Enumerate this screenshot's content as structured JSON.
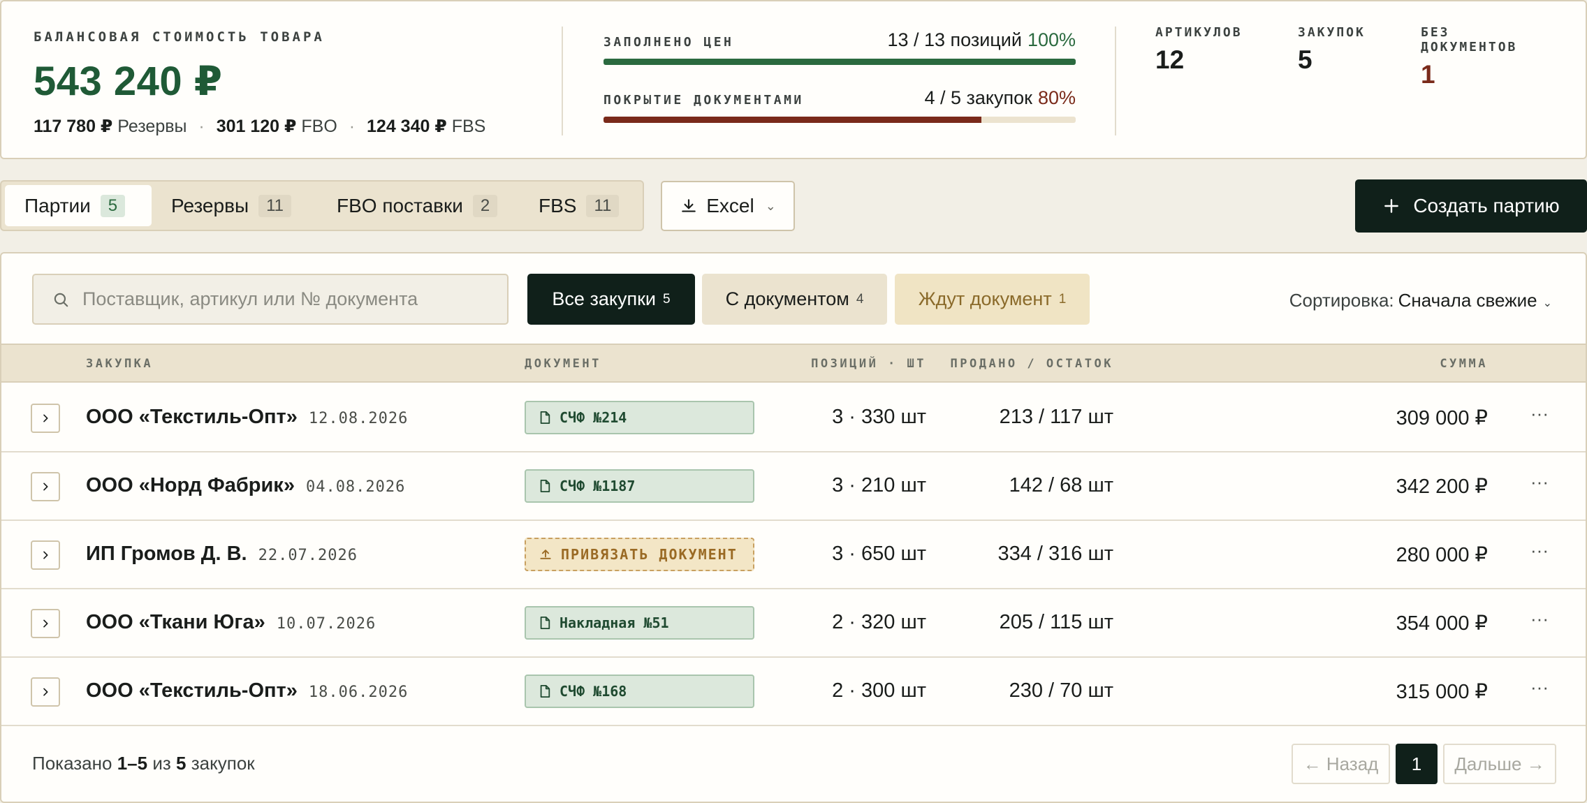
{
  "summary": {
    "balance_label": "Балансовая стоимость товара",
    "balance_value": "543 240 ₽",
    "breakdown": [
      {
        "value": "117 780 ₽",
        "label": "Резервы"
      },
      {
        "value": "301 120 ₽",
        "label": "FBO"
      },
      {
        "value": "124 340 ₽",
        "label": "FBS"
      }
    ],
    "breakdown_sep": "·",
    "prices": {
      "label": "Заполнено цен",
      "count": "13 / 13 позиций",
      "percent": "100%",
      "fill": 1.0
    },
    "docs": {
      "label": "Покрытие документами",
      "count": "4 / 5 закупок",
      "percent": "80%",
      "fill": 0.8
    },
    "stats": [
      {
        "label": "Артикулов",
        "value": "12"
      },
      {
        "label": "Закупок",
        "value": "5"
      },
      {
        "label": "Без документов",
        "value": "1"
      }
    ]
  },
  "tabs": [
    {
      "label": "Партии",
      "count": "5"
    },
    {
      "label": "Резервы",
      "count": "11"
    },
    {
      "label": "FBO поставки",
      "count": "2"
    },
    {
      "label": "FBS",
      "count": "11"
    }
  ],
  "toolbar": {
    "excel_label": "Excel",
    "create_label": "Создать партию"
  },
  "search": {
    "placeholder": "Поставщик, артикул или № документа"
  },
  "filters": [
    {
      "label": "Все закупки",
      "count": "5"
    },
    {
      "label": "С документом",
      "count": "4"
    },
    {
      "label": "Ждут документ",
      "count": "1"
    }
  ],
  "sort": {
    "label": "Сортировка:",
    "value": "Сначала свежие"
  },
  "table": {
    "headers": {
      "purchase": "Закупка",
      "document": "Документ",
      "positions": "Позиций · шт",
      "sold": "Продано / остаток",
      "sum": "Сумма"
    },
    "rows": [
      {
        "supplier": "ООО «Текстиль-Опт»",
        "date": "12.08.2026",
        "doc": "СЧФ №214",
        "doc_status": "ok",
        "positions": "3 · 330 шт",
        "sold": "213 / 117 шт",
        "sum": "309 000 ₽"
      },
      {
        "supplier": "ООО «Норд Фабрик»",
        "date": "04.08.2026",
        "doc": "СЧФ №1187",
        "doc_status": "ok",
        "positions": "3 · 210 шт",
        "sold": "142 / 68 шт",
        "sum": "342 200 ₽"
      },
      {
        "supplier": "ИП Громов Д. В.",
        "date": "22.07.2026",
        "doc": "ПРИВЯЗАТЬ ДОКУМЕНТ",
        "doc_status": "pending",
        "positions": "3 · 650 шт",
        "sold": "334 / 316 шт",
        "sum": "280 000 ₽"
      },
      {
        "supplier": "ООО «Ткани Юга»",
        "date": "10.07.2026",
        "doc": "Накладная №51",
        "doc_status": "ok",
        "positions": "2 · 320 шт",
        "sold": "205 / 115 шт",
        "sum": "354 000 ₽"
      },
      {
        "supplier": "ООО «Текстиль-Опт»",
        "date": "18.06.2026",
        "doc": "СЧФ №168",
        "doc_status": "ok",
        "positions": "2 · 300 шт",
        "sold": "230 / 70 шт",
        "sum": "315 000 ₽"
      }
    ],
    "more_glyph": "···"
  },
  "footer": {
    "prefix": "Показано",
    "range": "1–5",
    "of": "из",
    "total": "5",
    "suffix": "закупок"
  },
  "pagination": {
    "prev": "← Назад",
    "current": "1",
    "next": "Дальше →"
  },
  "colors": {
    "accent_green": "#2b6a3f",
    "accent_red": "#7a2a1a",
    "dark": "#10201a",
    "background": "#f2efe6"
  }
}
